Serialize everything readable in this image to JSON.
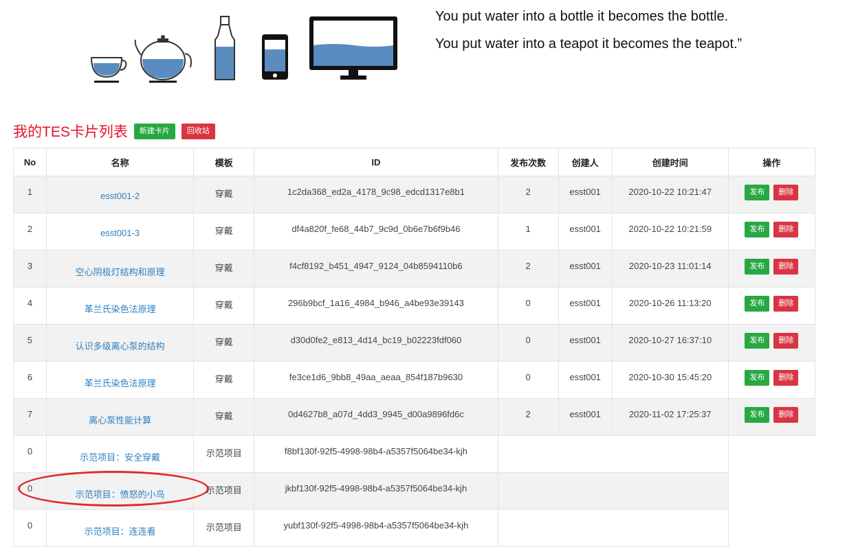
{
  "quote": {
    "line1": "You put water into a bottle it becomes the bottle.",
    "line2": "You put water into a teapot it becomes the teapot.”"
  },
  "illustration_icons": [
    "cup-icon",
    "teapot-icon",
    "bottle-icon",
    "phone-icon",
    "monitor-icon"
  ],
  "colors": {
    "water": "#5b8cc0",
    "accent_red": "#e8112b",
    "btn_green": "#27a843",
    "btn_red": "#d93543",
    "link": "#2d7fbf"
  },
  "list": {
    "title": "我的TES卡片列表",
    "new_card_label": "新建卡片",
    "recycle_label": "回收站"
  },
  "table": {
    "headers": {
      "no": "No",
      "name": "名称",
      "template": "模板",
      "id": "ID",
      "publish_count": "发布次数",
      "creator": "创建人",
      "created_at": "创建时间",
      "actions": "操作"
    },
    "publish_label": "发布",
    "delete_label": "删除",
    "rows": [
      {
        "no": "1",
        "name": "esst001-2",
        "template": "穿戴",
        "id": "1c2da368_ed2a_4178_9c98_edcd1317e8b1",
        "publish_count": "2",
        "creator": "esst001",
        "created_at": "2020-10-22 10:21:47"
      },
      {
        "no": "2",
        "name": "esst001-3",
        "template": "穿戴",
        "id": "df4a820f_fe68_44b7_9c9d_0b6e7b6f9b46",
        "publish_count": "1",
        "creator": "esst001",
        "created_at": "2020-10-22 10:21:59"
      },
      {
        "no": "3",
        "name": "空心阴极灯结构和原理",
        "template": "穿戴",
        "id": "f4cf8192_b451_4947_9124_04b8594110b6",
        "publish_count": "2",
        "creator": "esst001",
        "created_at": "2020-10-23 11:01:14"
      },
      {
        "no": "4",
        "name": "革兰氏染色法原理",
        "template": "穿戴",
        "id": "296b9bcf_1a16_4984_b946_a4be93e39143",
        "publish_count": "0",
        "creator": "esst001",
        "created_at": "2020-10-26 11:13:20"
      },
      {
        "no": "5",
        "name": "认识多级离心泵的结构",
        "template": "穿戴",
        "id": "d30d0fe2_e813_4d14_bc19_b02223fdf060",
        "publish_count": "0",
        "creator": "esst001",
        "created_at": "2020-10-27 16:37:10"
      },
      {
        "no": "6",
        "name": "革兰氏染色法原理",
        "template": "穿戴",
        "id": "fe3ce1d6_9bb8_49aa_aeaa_854f187b9630",
        "publish_count": "0",
        "creator": "esst001",
        "created_at": "2020-10-30 15:45:20"
      },
      {
        "no": "7",
        "name": "离心泵性能计算",
        "template": "穿戴",
        "id": "0d4627b8_a07d_4dd3_9945_d00a9896fd6c",
        "publish_count": "2",
        "creator": "esst001",
        "created_at": "2020-11-02 17:25:37"
      }
    ],
    "demo_rows": [
      {
        "no": "0",
        "name": "示范项目：安全穿戴",
        "template": "示范项目",
        "id": "f8bf130f-92f5-4998-98b4-a5357f5064be34-kjh"
      },
      {
        "no": "0",
        "name": "示范项目：愤怒的小鸟",
        "template": "示范项目",
        "id": "jkbf130f-92f5-4998-98b4-a5357f5064be34-kjh"
      },
      {
        "no": "0",
        "name": "示范项目：连连看",
        "template": "示范项目",
        "id": "yubf130f-92f5-4998-98b4-a5357f5064be34-kjh"
      }
    ]
  }
}
